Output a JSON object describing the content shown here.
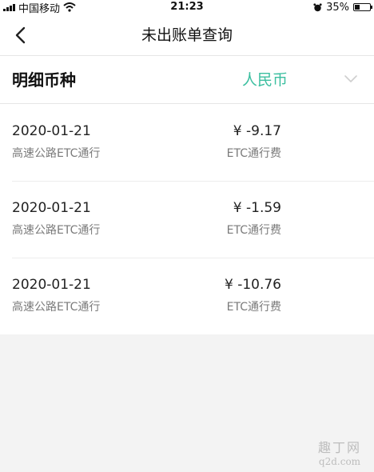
{
  "status_bar": {
    "carrier": "中国移动",
    "time": "21:23",
    "battery": "35%",
    "battery_level": 0.35
  },
  "header": {
    "title": "未出账单查询",
    "back_icon": "chevron-left-icon"
  },
  "currency": {
    "label": "明细币种",
    "value": "人民币",
    "value_color": "#3cbfa0",
    "dropdown_icon": "chevron-down-icon"
  },
  "transactions": [
    {
      "date": "2020-01-21",
      "description": "高速公路ETC通行",
      "amount": "¥ -9.17",
      "type": "ETC通行费"
    },
    {
      "date": "2020-01-21",
      "description": "高速公路ETC通行",
      "amount": "¥ -1.59",
      "type": "ETC通行费"
    },
    {
      "date": "2020-01-21",
      "description": "高速公路ETC通行",
      "amount": "¥ -10.76",
      "type": "ETC通行费"
    }
  ],
  "watermark": {
    "top": "趣丁网",
    "bottom": "q2d.com"
  }
}
